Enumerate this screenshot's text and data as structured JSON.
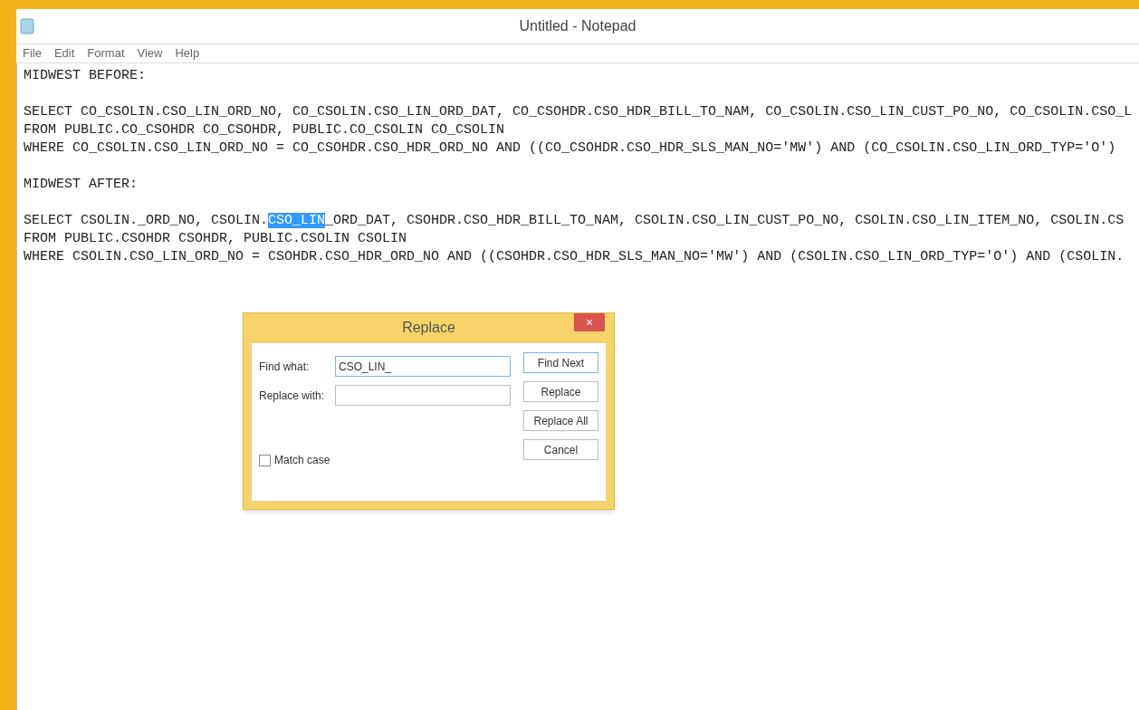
{
  "window": {
    "title": "Untitled - Notepad"
  },
  "menu": [
    "File",
    "Edit",
    "Format",
    "View",
    "Help"
  ],
  "editor": {
    "blocks": [
      [
        {
          "segments": [
            {
              "text": "MIDWEST BEFORE:",
              "selected": false
            }
          ]
        }
      ],
      [
        {
          "segments": [
            {
              "text": "SELECT CO_CSOLIN.CSO_LIN_ORD_NO, CO_CSOLIN.CSO_LIN_ORD_DAT, CO_CSOHDR.CSO_HDR_BILL_TO_NAM, CO_CSOLIN.CSO_LIN_CUST_PO_NO, CO_CSOLIN.CSO_L",
              "selected": false
            }
          ]
        },
        {
          "segments": [
            {
              "text": "FROM PUBLIC.CO_CSOHDR CO_CSOHDR, PUBLIC.CO_CSOLIN CO_CSOLIN",
              "selected": false
            }
          ]
        },
        {
          "segments": [
            {
              "text": "WHERE CO_CSOLIN.CSO_LIN_ORD_NO = CO_CSOHDR.CSO_HDR_ORD_NO AND ((CO_CSOHDR.CSO_HDR_SLS_MAN_NO='MW') AND (CO_CSOLIN.CSO_LIN_ORD_TYP='O')",
              "selected": false
            }
          ]
        }
      ],
      [
        {
          "segments": [
            {
              "text": "MIDWEST AFTER:",
              "selected": false
            }
          ]
        }
      ],
      [
        {
          "segments": [
            {
              "text": "SELECT CSOLIN._ORD_NO, CSOLIN.",
              "selected": false
            },
            {
              "text": "CSO_LIN",
              "selected": true
            },
            {
              "text": "_ORD_DAT, CSOHDR.CSO_HDR_BILL_TO_NAM, CSOLIN.CSO_LIN_CUST_PO_NO, CSOLIN.CSO_LIN_ITEM_NO, CSOLIN.CS",
              "selected": false
            }
          ]
        },
        {
          "segments": [
            {
              "text": "FROM PUBLIC.CSOHDR CSOHDR, PUBLIC.CSOLIN CSOLIN",
              "selected": false
            }
          ]
        },
        {
          "segments": [
            {
              "text": "WHERE CSOLIN.CSO_LIN_ORD_NO = CSOHDR.CSO_HDR_ORD_NO AND ((CSOHDR.CSO_HDR_SLS_MAN_NO='MW') AND (CSOLIN.CSO_LIN_ORD_TYP='O') AND (CSOLIN.",
              "selected": false
            }
          ]
        }
      ]
    ]
  },
  "dialog": {
    "title": "Replace",
    "close": "×",
    "fields": [
      {
        "label": "Find what:",
        "value": "CSO_LIN_",
        "focused": true
      },
      {
        "label": "Replace with:",
        "focused": false
      }
    ],
    "match_case": {
      "label": "Match case",
      "checked": false
    },
    "buttons": [
      {
        "label": "Find Next",
        "default": true
      },
      {
        "label": "Replace",
        "default": false
      },
      {
        "label": "Replace All",
        "default": false
      },
      {
        "label": "Cancel",
        "default": false
      }
    ]
  }
}
